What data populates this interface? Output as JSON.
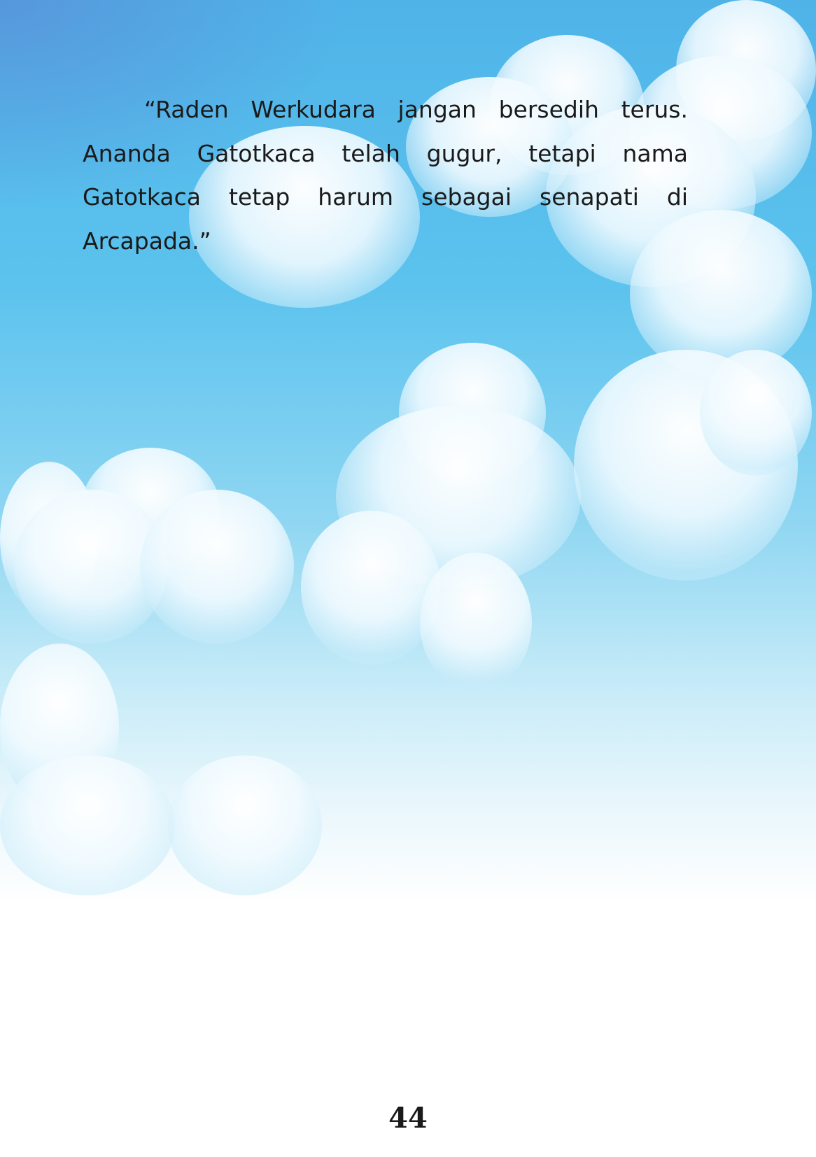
{
  "story": {
    "paragraph": "“Raden Werkudara jangan bersedih terus. Ananda Gatotkaca telah gugur, tetapi nama Gatotkaca tetap harum sebagai senapati di Arcapada.”"
  },
  "page_number": "44",
  "colors": {
    "sky_top": "#4fb3e8",
    "sky_bottom": "#ffffff",
    "text": "#1a1a1a"
  }
}
